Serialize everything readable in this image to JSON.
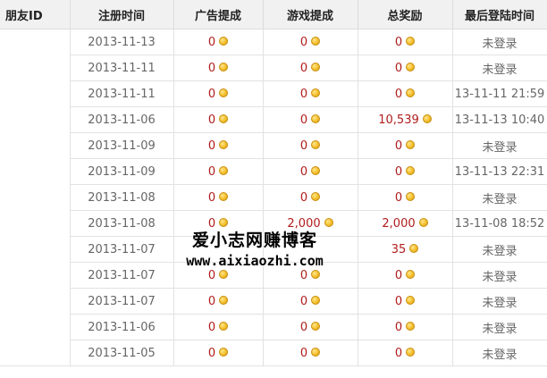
{
  "table": {
    "headers": [
      "朋友ID",
      "注册时间",
      "广告提成",
      "游戏提成",
      "总奖励",
      "最后登陆时间"
    ],
    "rows": [
      {
        "reg": "2013-11-13",
        "ad": "0",
        "game": "0",
        "total": "0",
        "last": "未登录"
      },
      {
        "reg": "2013-11-11",
        "ad": "0",
        "game": "0",
        "total": "0",
        "last": "未登录"
      },
      {
        "reg": "2013-11-11",
        "ad": "0",
        "game": "0",
        "total": "0",
        "last": "13-11-11 21:59"
      },
      {
        "reg": "2013-11-06",
        "ad": "0",
        "game": "0",
        "total": "10,539",
        "last": "13-11-13 10:40"
      },
      {
        "reg": "2013-11-09",
        "ad": "0",
        "game": "0",
        "total": "0",
        "last": "未登录"
      },
      {
        "reg": "2013-11-09",
        "ad": "0",
        "game": "0",
        "total": "0",
        "last": "13-11-13 22:31"
      },
      {
        "reg": "2013-11-08",
        "ad": "0",
        "game": "0",
        "total": "0",
        "last": "未登录"
      },
      {
        "reg": "2013-11-08",
        "ad": "0",
        "game": "2,000",
        "total": "2,000",
        "last": "13-11-08 18:52"
      },
      {
        "reg": "2013-11-07",
        "ad": "",
        "game": "",
        "total": "35",
        "last": "未登录"
      },
      {
        "reg": "2013-11-07",
        "ad": "0",
        "game": "0",
        "total": "0",
        "last": "未登录"
      },
      {
        "reg": "2013-11-07",
        "ad": "0",
        "game": "0",
        "total": "0",
        "last": "未登录"
      },
      {
        "reg": "2013-11-06",
        "ad": "0",
        "game": "0",
        "total": "0",
        "last": "未登录"
      },
      {
        "reg": "2013-11-05",
        "ad": "0",
        "game": "0",
        "total": "0",
        "last": "未登录"
      }
    ]
  },
  "watermark": {
    "line1": "爱小志网赚博客",
    "line2": "www.aixiaozhi.com"
  },
  "colors": {
    "value_red": "#b11c1c",
    "coin_gold": "#f3be2c",
    "header_bg": "#f1f1f1"
  },
  "icons": {
    "coin": "gold-coin-icon"
  }
}
